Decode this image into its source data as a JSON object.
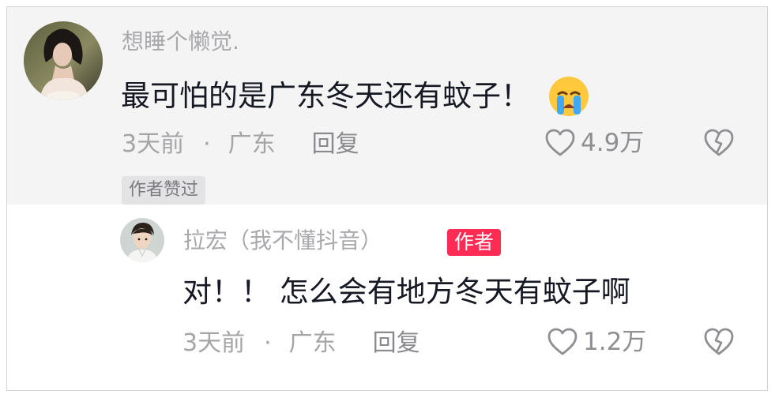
{
  "colors": {
    "background": "#ffffff",
    "highlight_background": "#f4f4f4",
    "username": "#a9a9ad",
    "text": "#161823",
    "meta": "#a5a5a8",
    "author_tag": "#fe2c55"
  },
  "comment": {
    "username": "想睡个懒觉.",
    "text": "最可怕的是广东冬天还有蚊子！",
    "emoji": "crying-face-icon",
    "time": "3天前",
    "separator": "·",
    "location": "广东",
    "reply_label": "回复",
    "like_count": "4.9万",
    "author_liked_badge": "作者赞过"
  },
  "reply": {
    "username": "拉宏（我不懂抖音）",
    "author_tag": "作者",
    "text": "对！！ 怎么会有地方冬天有蚊子啊",
    "time": "3天前",
    "separator": "·",
    "location": "广东",
    "reply_label": "回复",
    "like_count": "1.2万"
  }
}
